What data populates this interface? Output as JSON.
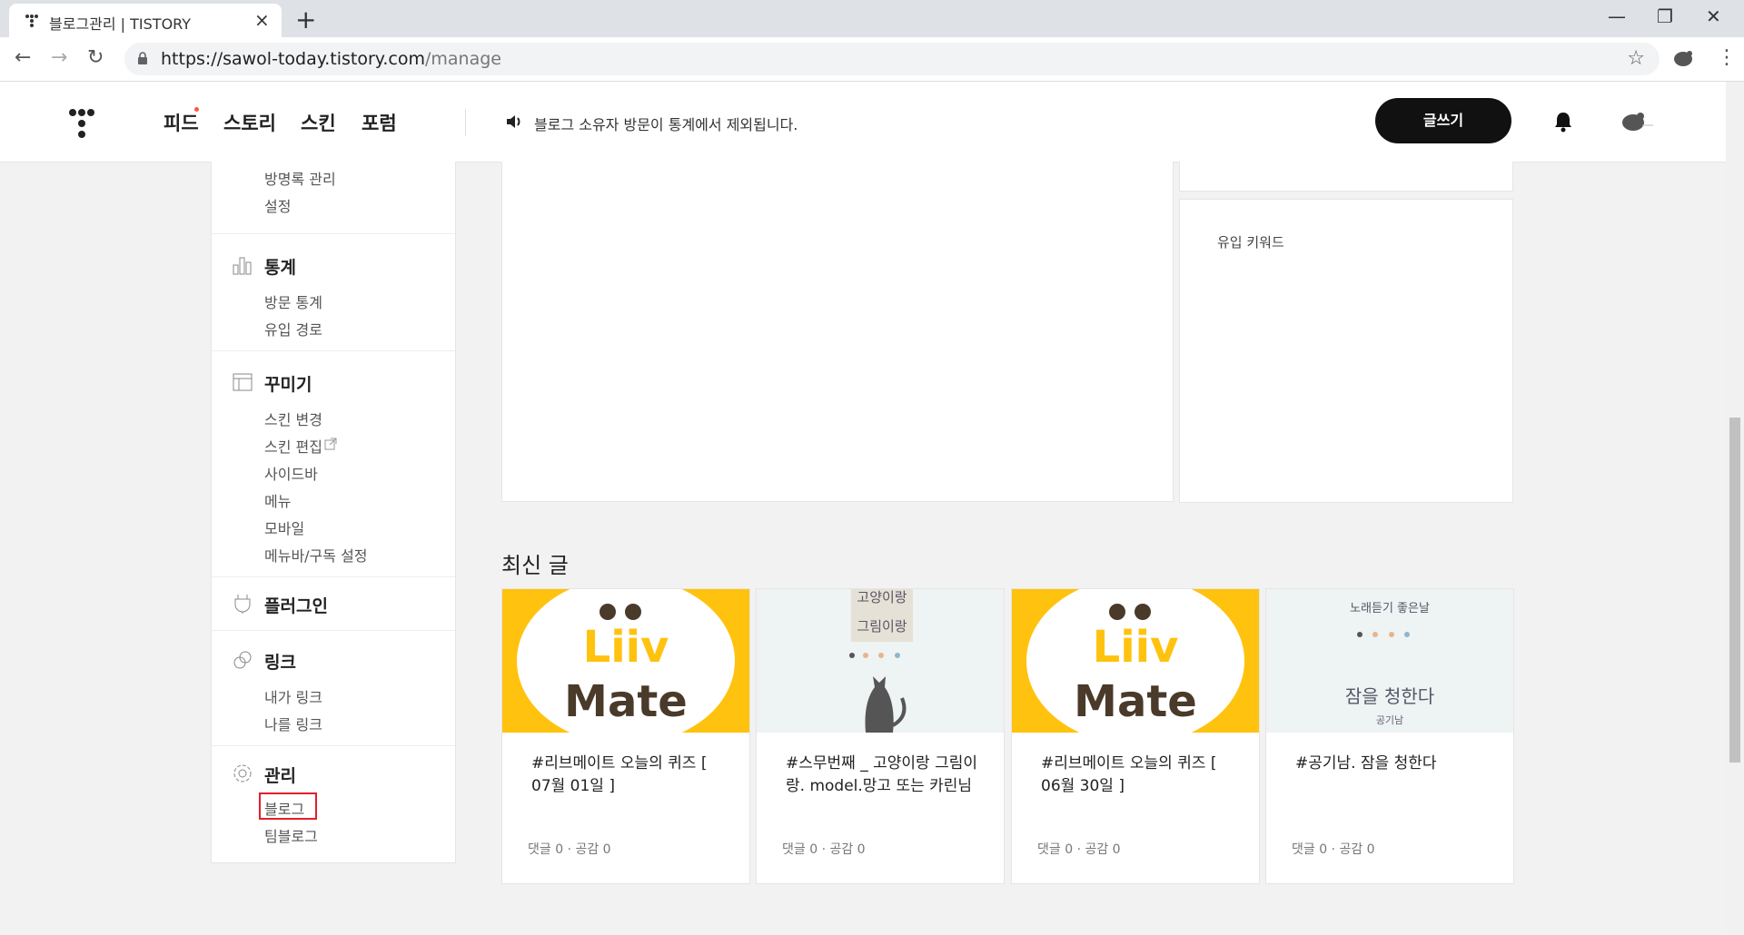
{
  "browser": {
    "tab_title": "블로그관리 | TISTORY",
    "tab_close": "×",
    "new_tab": "+",
    "url_host": "https://sawol-today.tistory.com",
    "url_path": "/manage",
    "window": {
      "minimize": "—",
      "restore": "❐",
      "close": "✕"
    },
    "nav": {
      "back": "←",
      "forward": "→",
      "reload": "↻"
    },
    "star": "☆",
    "menu": "⋮"
  },
  "header": {
    "nav": [
      "피드",
      "스토리",
      "스킨",
      "포럼"
    ],
    "notice": "블로그 소유자 방문이 통계에서 제외됩니다.",
    "write_button": "글쓰기"
  },
  "sidebar": {
    "top_items": [
      "방명록 관리",
      "설정"
    ],
    "stats": {
      "title": "통계",
      "items": [
        "방문 통계",
        "유입 경로"
      ]
    },
    "design": {
      "title": "꾸미기",
      "items": [
        "스킨 변경",
        "스킨 편집",
        "사이드바",
        "메뉴",
        "모바일",
        "메뉴바/구독 설정"
      ]
    },
    "plugin": {
      "title": "플러그인"
    },
    "link": {
      "title": "링크",
      "items": [
        "내가 링크",
        "나를 링크"
      ]
    },
    "manage": {
      "title": "관리",
      "items": [
        "블로그",
        "팀블로그"
      ]
    }
  },
  "main": {
    "keywords_label": "유입 키워드",
    "recent_title": "최신 글",
    "posts": [
      {
        "title": "#리브메이트 오늘의 퀴즈 [ 07월 01일 ]",
        "meta": "댓글 0 · 공감 0",
        "thumb": "liiv"
      },
      {
        "title": "#스무번째 _ 고양이랑 그림이랑. model.망고 또는 카린님",
        "meta": "댓글 0 · 공감 0",
        "thumb": "cat"
      },
      {
        "title": "#리브메이트 오늘의 퀴즈 [ 06월 30일 ]",
        "meta": "댓글 0 · 공감 0",
        "thumb": "liiv"
      },
      {
        "title": "#공기남. 잠을 청한다",
        "meta": "댓글 0 · 공감 0",
        "thumb": "sleep"
      }
    ],
    "thumb_text": {
      "liiv_top": "Liiv",
      "liiv_bottom": "Mate",
      "cat_a": "고양이랑",
      "cat_b": "그림이랑",
      "sleep_top": "노래듣기 좋은날",
      "sleep_main": "잠을 청한다",
      "sleep_small": "공기남"
    }
  },
  "colors": {
    "accent_red": "#ff5544",
    "liiv_yellow": "#ffc20e",
    "liiv_brown": "#4a3a2a",
    "dark": "#111111",
    "highlight": "#e0202a"
  }
}
